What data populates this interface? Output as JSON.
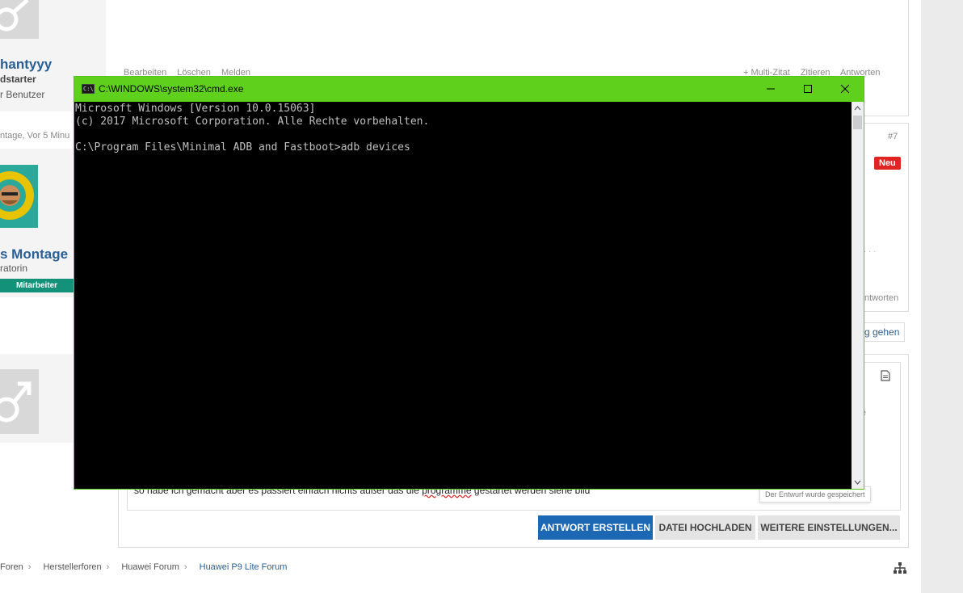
{
  "window": {
    "title": "C:\\WINDOWS\\system32\\cmd.exe",
    "icon_label": "C:\\",
    "icon": "cmd-console-icon"
  },
  "console": {
    "lines": [
      "Microsoft Windows [Version 10.0.15063]",
      "(c) 2017 Microsoft Corporation. Alle Rechte vorbehalten.",
      "",
      "C:\\Program Files\\Minimal ADB and Fastboot>adb devices"
    ]
  },
  "post1": {
    "username": "hantyyy",
    "role": "dstarter",
    "usertitle": "r Benutzer",
    "actions": {
      "edit": "Bearbeiten",
      "delete": "Löschen",
      "report": "Melden",
      "multiquote": "+ Multi-Zitat",
      "quote": "Zitieren",
      "reply": "Antworten"
    }
  },
  "post2": {
    "date": "ntage, Vor 5 Minu",
    "number": "#7",
    "new_badge": "Neu",
    "username": "s Montage",
    "role": "ratorin",
    "badge": "Mitarbeiter",
    "reply": "ntworten",
    "ellipsis": ". . ."
  },
  "goto_link": "g gehen",
  "editor": {
    "text_before": "so habe ich gemacht aber es passiert einfach nichts außer das die ",
    "text_typo": "programme",
    "text_after": " gestartet werden siehe bild",
    "draft_saved": "Der Entwurf wurde gespeichert",
    "stray_char": "e"
  },
  "buttons": {
    "reply": "ANTWORT ERSTELLEN",
    "upload": "DATEI HOCHLADEN",
    "more": "WEITERE EINSTELLUNGEN..."
  },
  "breadcrumb": [
    "Foren",
    "Herstellerforen",
    "Huawei Forum",
    "Huawei P9 Lite Forum"
  ],
  "colors": {
    "titlebar": "#5fd11d",
    "console_bg": "#000000",
    "console_text": "#c0c0c0",
    "link": "#2a5f96",
    "primary_button": "#1d68b5",
    "staff_badge": "#149179",
    "new_badge": "#e02424"
  }
}
